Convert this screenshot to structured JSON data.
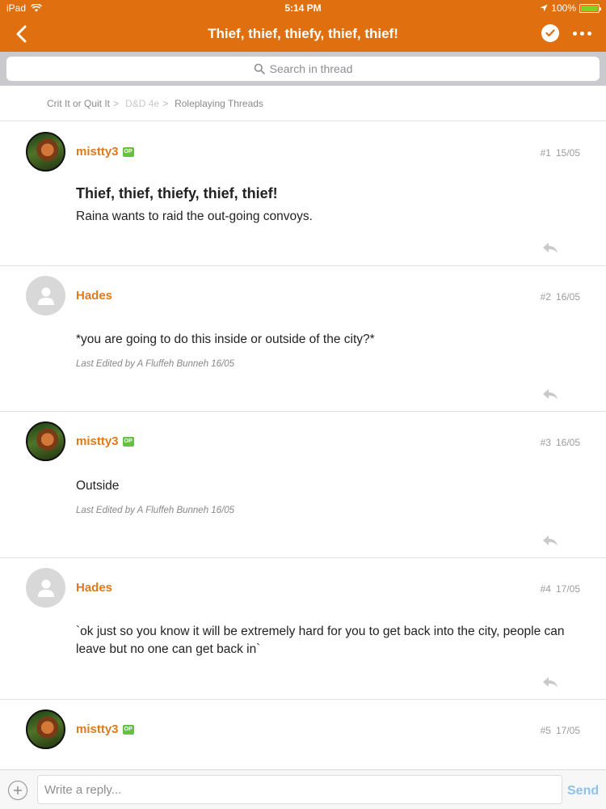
{
  "status_bar": {
    "device": "iPad",
    "time": "5:14 PM",
    "battery": "100%"
  },
  "header": {
    "title": "Thief, thief, thiefy, thief, thief!"
  },
  "search": {
    "placeholder": "Search in thread"
  },
  "breadcrumb": [
    {
      "label": "Crit It or Quit It"
    },
    {
      "label": "D&D 4e"
    },
    {
      "label": "Roleplaying Threads"
    }
  ],
  "op_label": "OP",
  "posts": [
    {
      "username": "mistty3",
      "is_op": true,
      "number": "#1",
      "date": "15/05",
      "title": "Thief, thief, thiefy, thief, thief!",
      "body": "Raina wants to raid the out-going convoys.",
      "edited": ""
    },
    {
      "username": "Hades",
      "is_op": false,
      "number": "#2",
      "date": "16/05",
      "title": "",
      "body": "*you are going to do this inside or outside of the city?*",
      "edited": "Last Edited by A Fluffeh Bunneh 16/05"
    },
    {
      "username": "mistty3",
      "is_op": true,
      "number": "#3",
      "date": "16/05",
      "title": "",
      "body": "Outside",
      "edited": "Last Edited by A Fluffeh Bunneh 16/05"
    },
    {
      "username": "Hades",
      "is_op": false,
      "number": "#4",
      "date": "17/05",
      "title": "",
      "body": "`ok just so you know it will be extremely hard for you to get back into the city, people can leave but no one can get back in`",
      "edited": ""
    },
    {
      "username": "mistty3",
      "is_op": true,
      "number": "#5",
      "date": "17/05",
      "title": "",
      "body": "",
      "edited": ""
    }
  ],
  "composer": {
    "placeholder": "Write a reply...",
    "send_label": "Send"
  },
  "colors": {
    "header": "#e0700f",
    "username": "#dd7b1b",
    "op_badge": "#64c33c",
    "send": "#8ec2ec"
  }
}
